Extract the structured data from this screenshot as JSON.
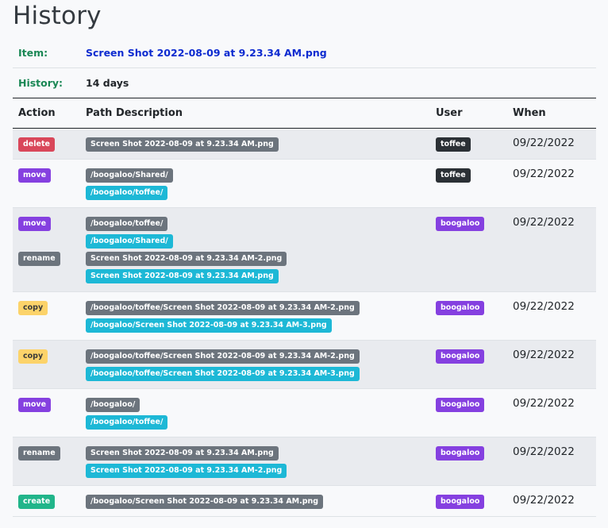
{
  "title": "History",
  "info": {
    "item_label": "Item:",
    "item_value": "Screen Shot 2022-08-09 at 9.23.34 AM.png",
    "history_label": "History:",
    "history_value": "14 days"
  },
  "columns": [
    "Action",
    "Path Description",
    "User",
    "When"
  ],
  "rows": [
    {
      "actions": [
        "delete"
      ],
      "paths": [
        {
          "t": "Screen Shot 2022-08-09 at 9.23.34 AM.png",
          "k": "src"
        }
      ],
      "user": "toffee",
      "user_style": "dark",
      "when": "09/22/2022"
    },
    {
      "actions": [
        "move"
      ],
      "paths": [
        {
          "t": "/boogaloo/Shared/",
          "k": "src"
        },
        {
          "t": "/boogaloo/toffee/",
          "k": "dst"
        }
      ],
      "user": "toffee",
      "user_style": "dark",
      "when": "09/22/2022"
    },
    {
      "actions": [
        "move",
        "rename"
      ],
      "paths": [
        {
          "t": "/boogaloo/toffee/",
          "k": "src"
        },
        {
          "t": "/boogaloo/Shared/",
          "k": "dst"
        },
        {
          "t": "Screen Shot 2022-08-09 at 9.23.34 AM-2.png",
          "k": "src"
        },
        {
          "t": "Screen Shot 2022-08-09 at 9.23.34 AM.png",
          "k": "dst"
        }
      ],
      "user": "boogaloo",
      "user_style": "purple",
      "when": "09/22/2022"
    },
    {
      "actions": [
        "copy"
      ],
      "paths": [
        {
          "t": "/boogaloo/toffee/Screen Shot 2022-08-09 at 9.23.34 AM-2.png",
          "k": "src"
        },
        {
          "t": "/boogaloo/Screen Shot 2022-08-09 at 9.23.34 AM-3.png",
          "k": "dst"
        }
      ],
      "user": "boogaloo",
      "user_style": "purple",
      "when": "09/22/2022"
    },
    {
      "actions": [
        "copy"
      ],
      "paths": [
        {
          "t": "/boogaloo/toffee/Screen Shot 2022-08-09 at 9.23.34 AM-2.png",
          "k": "src"
        },
        {
          "t": "/boogaloo/toffee/Screen Shot 2022-08-09 at 9.23.34 AM-3.png",
          "k": "dst"
        }
      ],
      "user": "boogaloo",
      "user_style": "purple",
      "when": "09/22/2022"
    },
    {
      "actions": [
        "move"
      ],
      "paths": [
        {
          "t": "/boogaloo/",
          "k": "src"
        },
        {
          "t": "/boogaloo/toffee/",
          "k": "dst"
        }
      ],
      "user": "boogaloo",
      "user_style": "purple",
      "when": "09/22/2022"
    },
    {
      "actions": [
        "rename"
      ],
      "paths": [
        {
          "t": "Screen Shot 2022-08-09 at 9.23.34 AM.png",
          "k": "src"
        },
        {
          "t": "Screen Shot 2022-08-09 at 9.23.34 AM-2.png",
          "k": "dst"
        }
      ],
      "user": "boogaloo",
      "user_style": "purple",
      "when": "09/22/2022"
    },
    {
      "actions": [
        "create"
      ],
      "paths": [
        {
          "t": "/boogaloo/Screen Shot 2022-08-09 at 9.23.34 AM.png",
          "k": "src"
        }
      ],
      "user": "boogaloo",
      "user_style": "purple",
      "when": "09/22/2022"
    }
  ]
}
